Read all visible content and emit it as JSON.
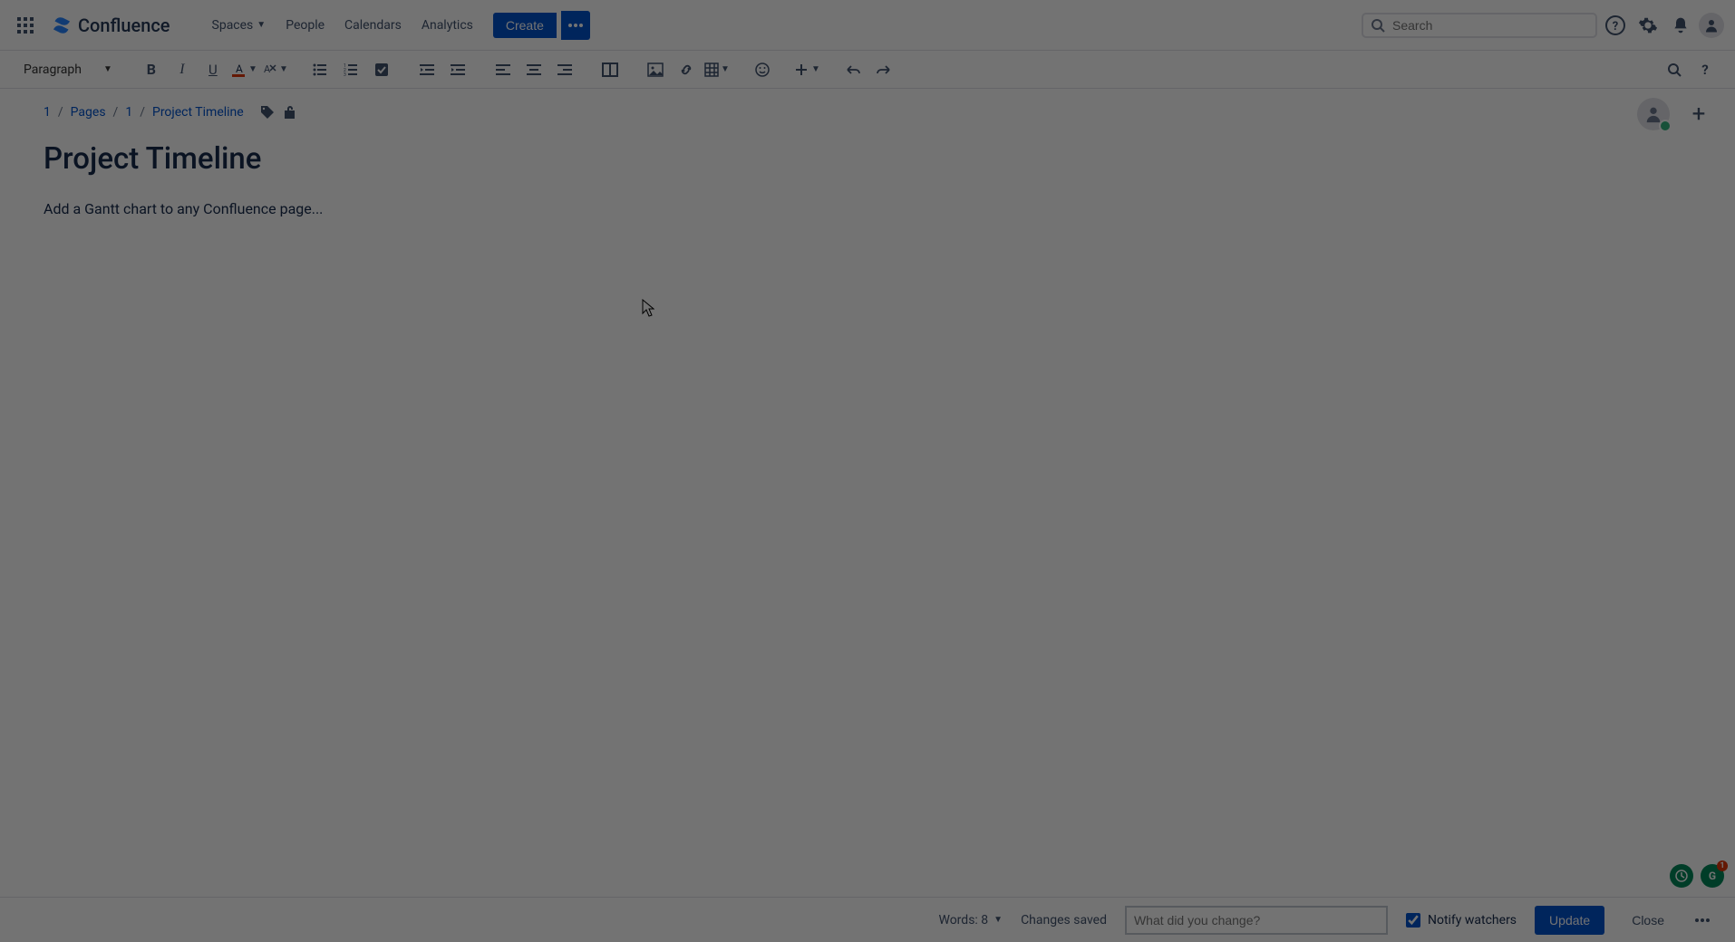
{
  "header": {
    "product": "Confluence",
    "nav": {
      "spaces": "Spaces",
      "people": "People",
      "calendars": "Calendars",
      "analytics": "Analytics"
    },
    "create_label": "Create",
    "search_placeholder": "Search"
  },
  "toolbar": {
    "style_label": "Paragraph"
  },
  "breadcrumbs": {
    "item0": "1",
    "item1": "Pages",
    "item2": "1",
    "item3": "Project Timeline"
  },
  "page": {
    "title": "Project Timeline",
    "body": "Add a Gantt chart to any Confluence page..."
  },
  "footer": {
    "words_label": "Words: 8",
    "status": "Changes saved",
    "change_placeholder": "What did you change?",
    "notify_label": "Notify watchers",
    "update_label": "Update",
    "close_label": "Close"
  },
  "widgets": {
    "g_badge": "1"
  }
}
